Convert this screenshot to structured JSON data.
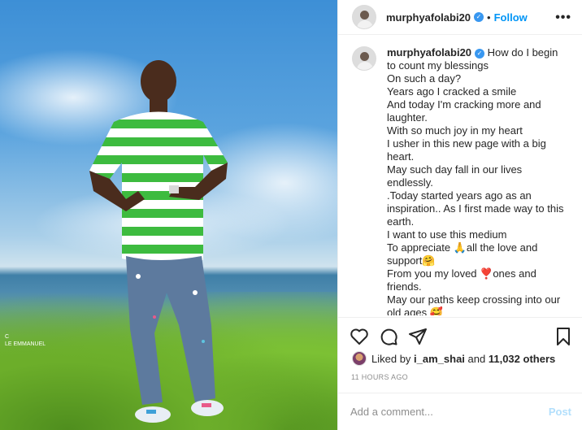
{
  "photo": {
    "watermark_line1": "C",
    "watermark_line2": "LE EMMANUEL"
  },
  "post": {
    "username": "murphyafolabi20",
    "separator": "•",
    "follow_label": "Follow",
    "more_label": "•••",
    "caption_lines": [
      "How do I begin",
      "to count my blessings",
      "On such a day?",
      "Years ago I cracked a smile",
      "And today I'm cracking more and",
      "laughter.",
      "With so much joy in my heart",
      "I usher in this new page with a big",
      "heart.",
      "May such day fall in our lives",
      "endlessly.",
      ".Today started years ago as an",
      "inspiration.. As I first made way to this",
      "earth.",
      "I want to use this medium",
      "To appreciate 🙏all the love and",
      "support🤗",
      "From you my loved ❣️ones and",
      "friends.",
      "May our paths keep crossing into our",
      "old ages 🥰"
    ]
  },
  "likes": {
    "prefix": "Liked by ",
    "user": "i_am_shai",
    "middle": " and ",
    "count": "11,032 others"
  },
  "timestamp": "11 HOURS AGO",
  "comment": {
    "placeholder": "Add a comment...",
    "post_label": "Post"
  },
  "colors": {
    "link_blue": "#0095f6",
    "verified_blue": "#3897f0",
    "post_disabled": "#b2dffc"
  }
}
